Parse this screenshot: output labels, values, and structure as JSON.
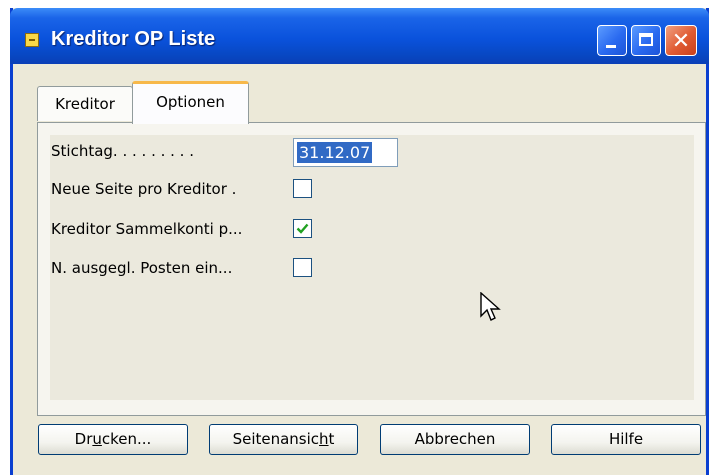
{
  "window": {
    "title": "Kreditor OP Liste",
    "icon": "app-icon"
  },
  "title_buttons": {
    "minimize": "minimize-icon",
    "maximize": "maximize-icon",
    "close": "close-icon",
    "close_glyph": "✕"
  },
  "tabs": [
    {
      "label": "Kreditor",
      "active": false
    },
    {
      "label": "Optionen",
      "active": true
    }
  ],
  "options": {
    "stichtag": {
      "label": "Stichtag. . . . . . . . .",
      "value": "31.12.07"
    },
    "neue_seite": {
      "label": "Neue Seite pro Kreditor  .",
      "checked": false
    },
    "sammelkonti": {
      "label": "Kreditor Sammelkonti p...",
      "checked": true
    },
    "ausgegl": {
      "label": "N. ausgegl. Posten ein...",
      "checked": false
    }
  },
  "buttons": {
    "drucken": {
      "pre": "Dr",
      "mnemonic": "u",
      "post": "cken..."
    },
    "seitenansicht": {
      "pre": "Seitenansic",
      "mnemonic": "h",
      "post": "t"
    },
    "abbrechen": {
      "label": "Abbrechen"
    },
    "hilfe": {
      "label": "Hilfe"
    }
  },
  "colors": {
    "titlebar": "#0a52dc",
    "accent_tab": "#f7b84a",
    "selection": "#316ac5",
    "check": "#21a121",
    "window_bg": "#ece9d8"
  }
}
